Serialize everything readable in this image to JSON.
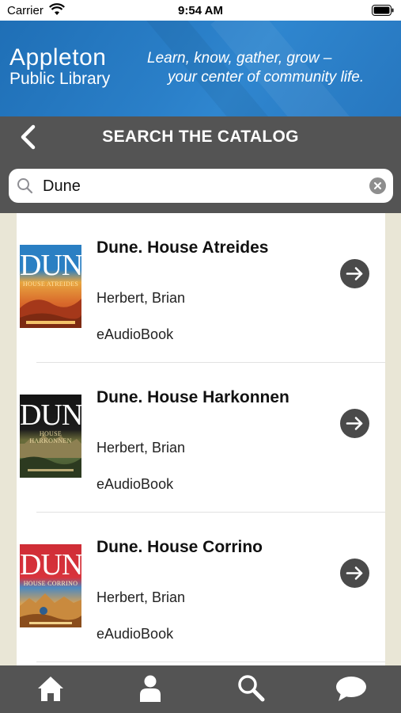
{
  "status_bar": {
    "carrier": "Carrier",
    "time": "9:54 AM"
  },
  "banner": {
    "logo_line1": "Appleton",
    "logo_line2": "Public Library",
    "tagline_line1": "Learn, know, gather, grow –",
    "tagline_line2": "your center of community life."
  },
  "header": {
    "title": "SEARCH THE CATALOG",
    "back_icon": "chevron-left-icon"
  },
  "search": {
    "value": "Dune",
    "icon": "search-icon",
    "clear_icon": "clear-icon"
  },
  "results": [
    {
      "title": "Dune. House Atreides",
      "author": "Herbert, Brian",
      "format": "eAudioBook",
      "cover_title": "DUNE",
      "cover_subtitle": "HOUSE ATREIDES"
    },
    {
      "title": "Dune. House Harkonnen",
      "author": "Herbert, Brian",
      "format": "eAudioBook",
      "cover_title": "DUNE",
      "cover_subtitle": "HOUSE HARKONNEN"
    },
    {
      "title": "Dune. House Corrino",
      "author": "Herbert, Brian",
      "format": "eAudioBook",
      "cover_title": "DUNE",
      "cover_subtitle": "HOUSE CORRINO"
    }
  ],
  "tabs": [
    "home-icon",
    "person-icon",
    "search-icon",
    "chat-bubble-icon"
  ],
  "colors": {
    "banner_blue": "#2a7fc8",
    "header_gray": "#545454",
    "page_beige": "#e9e6d6",
    "arrow_button": "#4a4a4a"
  }
}
